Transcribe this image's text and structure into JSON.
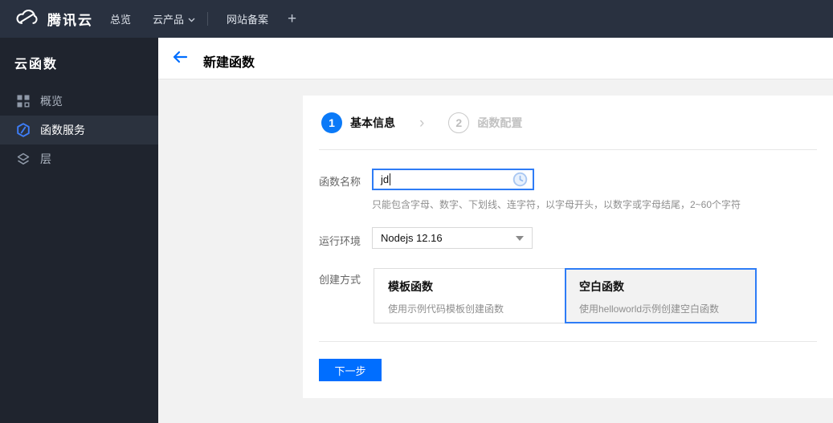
{
  "topbar": {
    "brand": "腾讯云",
    "nav": [
      {
        "label": "总览"
      },
      {
        "label": "云产品",
        "has_caret": true
      },
      {
        "label": "网站备案"
      }
    ],
    "add_tab": "+"
  },
  "sidebar": {
    "title": "云函数",
    "items": [
      {
        "label": "概览",
        "icon": "grid-icon",
        "active": false
      },
      {
        "label": "函数服务",
        "icon": "function-badge-icon",
        "active": true
      },
      {
        "label": "层",
        "icon": "layers-icon",
        "active": false
      }
    ]
  },
  "header": {
    "title": "新建函数",
    "back_icon": "back-arrow-icon"
  },
  "wizard": {
    "separator": "›",
    "steps": [
      {
        "number": "1",
        "label": "基本信息",
        "active": true
      },
      {
        "number": "2",
        "label": "函数配置",
        "active": false
      }
    ]
  },
  "form": {
    "name": {
      "label": "函数名称",
      "value": "jd",
      "status_icon": "clock-icon",
      "hint": "只能包含字母、数字、下划线、连字符，以字母开头，以数字或字母结尾，2~60个字符"
    },
    "runtime": {
      "label": "运行环境",
      "value": "Nodejs 12.16"
    },
    "method": {
      "label": "创建方式",
      "options": [
        {
          "title": "模板函数",
          "desc": "使用示例代码模板创建函数",
          "selected": false
        },
        {
          "title": "空白函数",
          "desc": "使用helloworld示例创建空白函数",
          "selected": true
        }
      ]
    },
    "next_button": "下一步"
  },
  "colors": {
    "accent": "#006eff",
    "topbar_bg": "#293140",
    "sidebar_bg": "#1f242e",
    "sidebar_active_bg": "#2b323e",
    "step_active": "#0b7af8",
    "selected_card_border": "#2e7cf6",
    "content_bg": "#f2f2f2"
  }
}
